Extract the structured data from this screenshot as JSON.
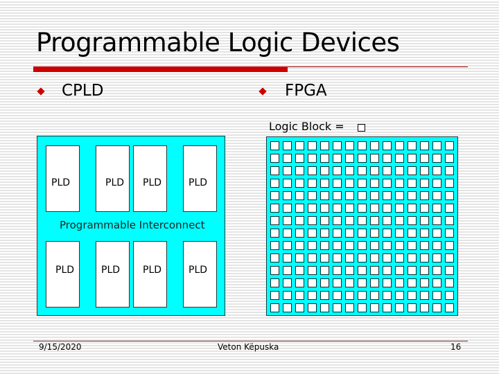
{
  "slide": {
    "title": "Programmable Logic Devices",
    "accent_color": "#cc0000",
    "diagram_fill": "#00ffff"
  },
  "bullets": [
    {
      "label": "CPLD"
    },
    {
      "label": "FPGA"
    }
  ],
  "cpld": {
    "interconnect_label": "Programmable Interconnect",
    "top_row": [
      "PLD",
      "PLD",
      "PLD",
      "PLD"
    ],
    "bottom_row": [
      "PLD",
      "PLD",
      "PLD",
      "PLD"
    ]
  },
  "fpga": {
    "legend_label": "Logic Block =",
    "rows": 14,
    "cols": 15
  },
  "footer": {
    "date": "9/15/2020",
    "author": "Veton Këpuska",
    "page": "16"
  }
}
